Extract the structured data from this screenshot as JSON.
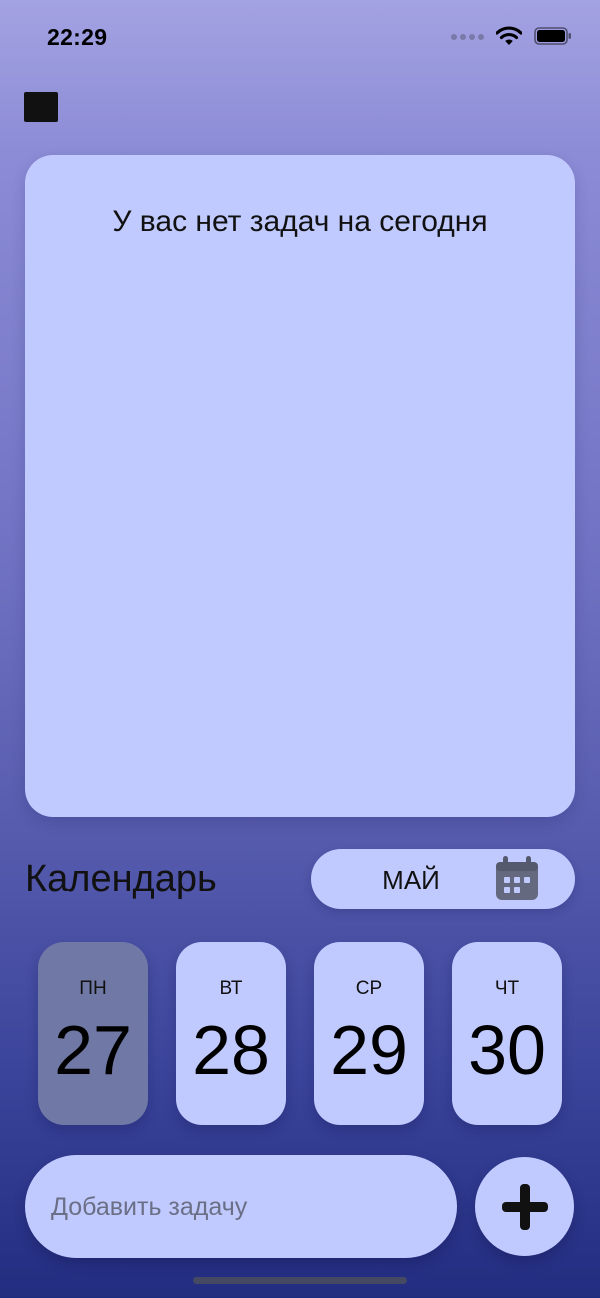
{
  "status_bar": {
    "time": "22:29",
    "icons": [
      "signal-icon",
      "wifi-icon",
      "battery-icon"
    ]
  },
  "menu": {
    "icon": "menu-icon"
  },
  "tasks": {
    "empty_message": "У вас нет задач на сегодня"
  },
  "calendar": {
    "title": "Календарь",
    "month": "МАЙ",
    "month_icon": "calendar-icon",
    "days": [
      {
        "weekday": "ПН",
        "day": "27",
        "selected": true
      },
      {
        "weekday": "ВТ",
        "day": "28",
        "selected": false
      },
      {
        "weekday": "СР",
        "day": "29",
        "selected": false
      },
      {
        "weekday": "ЧТ",
        "day": "30",
        "selected": false
      }
    ]
  },
  "add_task": {
    "placeholder": "Добавить задачу",
    "value": "",
    "button_icon": "plus-icon"
  },
  "colors": {
    "card_background": "#c1caff",
    "selected_day": "#7079a6",
    "gradient_top": "#a3a2e2",
    "gradient_bottom": "#232d80"
  }
}
